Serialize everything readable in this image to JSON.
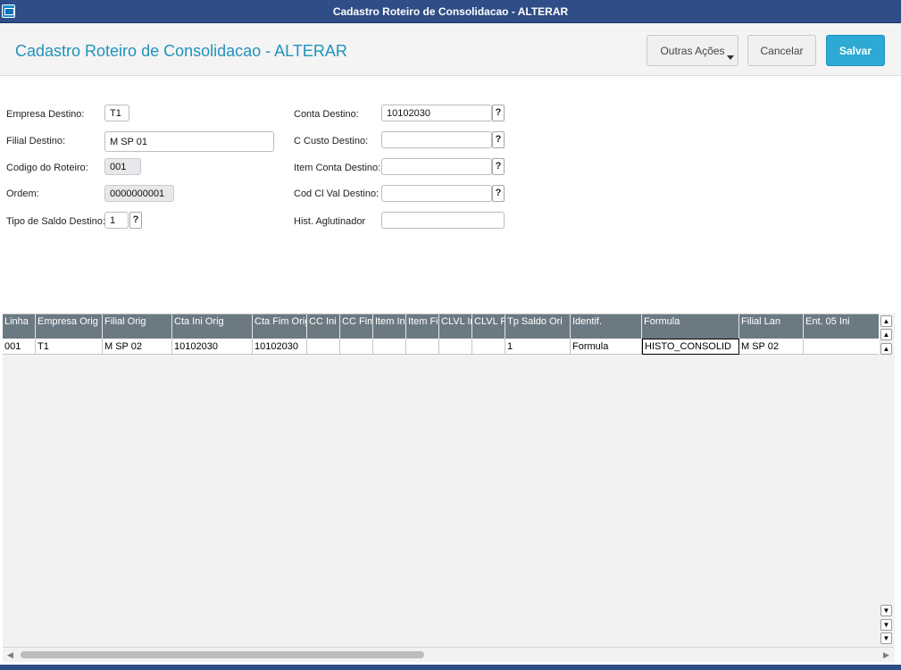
{
  "window": {
    "title": "Cadastro Roteiro de Consolidacao - ALTERAR",
    "icon": "app-icon"
  },
  "header": {
    "page_title": "Cadastro Roteiro de Consolidacao - ALTERAR",
    "other_actions_label": "Outras Ações",
    "cancel_label": "Cancelar",
    "save_label": "Salvar",
    "accent_color": "#2ea9d4"
  },
  "form": {
    "empresa_destino": {
      "label": "Empresa Destino:",
      "value": "T1"
    },
    "filial_destino": {
      "label": "Filial Destino:",
      "value": "M SP 01"
    },
    "codigo_roteiro": {
      "label": "Codigo do Roteiro:",
      "value": "001"
    },
    "ordem": {
      "label": "Ordem:",
      "value": "0000000001"
    },
    "tipo_saldo_destino": {
      "label": "Tipo de Saldo Destino:",
      "value": "1"
    },
    "conta_destino": {
      "label": "Conta Destino:",
      "value": "10102030"
    },
    "c_custo_destino": {
      "label": "C Custo Destino:",
      "value": ""
    },
    "item_conta_destino": {
      "label": "Item Conta Destino:",
      "value": ""
    },
    "cod_cl_val_destino": {
      "label": "Cod Cl Val Destino:",
      "value": ""
    },
    "hist_aglutinador": {
      "label": "Hist. Aglutinador",
      "value": ""
    },
    "lookup_label": "?"
  },
  "grid": {
    "columns": [
      "Linha",
      "Empresa Orig",
      "Filial Orig",
      "Cta Ini Orig",
      "Cta Fim Orig",
      "CC Ini Orig",
      "CC Fim Orig",
      "Item Ini Orig",
      "Item Fim Orig",
      "CLVL Ini Orig",
      "CLVL Fim Orig",
      "Tp Saldo Ori",
      "Identif.",
      "Formula",
      "Filial Lan",
      "Ent. 05 Ini"
    ],
    "rows": [
      [
        "001",
        "T1",
        "M SP 02",
        "10102030",
        "10102030",
        "",
        "",
        "",
        "",
        "",
        "",
        "1",
        "Formula",
        "HISTO_CONSOLID",
        "M SP 02",
        ""
      ]
    ]
  }
}
